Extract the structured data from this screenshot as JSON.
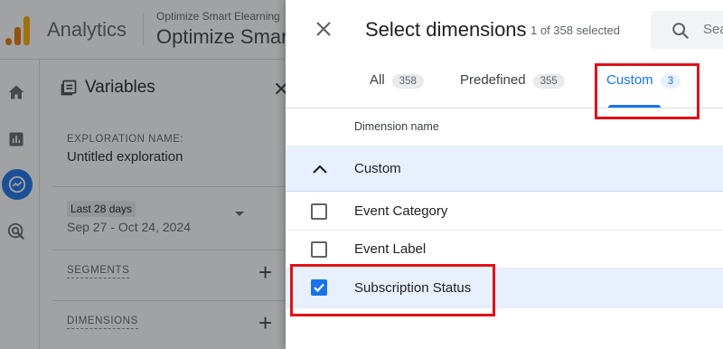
{
  "app": {
    "title": "Analytics",
    "account_small": "Optimize Smart Elearning",
    "account_large": "Optimize Smart Elearning"
  },
  "variables": {
    "title": "Variables",
    "exploration_label": "EXPLORATION NAME:",
    "exploration_name": "Untitled exploration",
    "date_chip": "Last 28 days",
    "date_range": "Sep 27 - Oct 24, 2024",
    "segments_label": "SEGMENTS",
    "dimensions_label": "DIMENSIONS"
  },
  "dialog": {
    "title": "Select dimensions",
    "count_text": "1 of 358 selected",
    "search_placeholder": "Search",
    "tabs": [
      {
        "label": "All",
        "count": "358"
      },
      {
        "label": "Predefined",
        "count": "355"
      },
      {
        "label": "Custom",
        "count": "3"
      }
    ],
    "column_header": "Dimension name",
    "group_label": "Custom",
    "rows": [
      {
        "label": "Event Category",
        "checked": false
      },
      {
        "label": "Event Label",
        "checked": false
      },
      {
        "label": "Subscription Status",
        "checked": true
      }
    ]
  },
  "colors": {
    "accent": "#1a73e8",
    "highlight": "#e0101b",
    "selected_row": "#e8f0fe"
  }
}
